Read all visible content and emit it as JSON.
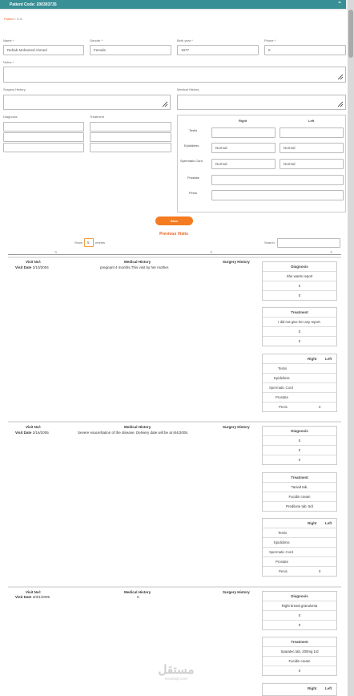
{
  "header": {
    "title": "Patient Code: 200303735"
  },
  "breadcrumb": {
    "home": "Patient",
    "current": "Edit"
  },
  "form": {
    "name": {
      "label": "Name *",
      "value": "Rehab Mohamed Ahmed"
    },
    "gender": {
      "label": "Gender *",
      "value": "Female"
    },
    "birth_year": {
      "label": "Birth year *",
      "value": "1977"
    },
    "phone": {
      "label": "Phone *",
      "value": "0"
    },
    "notes": {
      "label": "Notes *"
    },
    "surgery_history": {
      "label": "Surgery History"
    },
    "medical_history": {
      "label": "Medical History"
    },
    "diagnosis": {
      "label": "Diagnosis"
    },
    "treatment": {
      "label": "Treatment"
    }
  },
  "exam": {
    "right_label": "Right",
    "left_label": "Left",
    "rows": [
      {
        "label": "Testis",
        "right": "",
        "left": ""
      },
      {
        "label": "Epididimis",
        "right": "Normal",
        "left": "Normal"
      },
      {
        "label": "Spermatic Cord",
        "right": "Normal",
        "left": "Normal"
      },
      {
        "label": "Prostate",
        "right": "",
        "left": ""
      },
      {
        "label": "Penis",
        "right": "",
        "left": ""
      }
    ]
  },
  "save_label": "Save",
  "previous_visits": {
    "title": "Previous Visits",
    "show_label": "Show",
    "show_value": "5",
    "entries_label": "entries",
    "search_label": "Search:",
    "visit_no_label": "Visit No/:",
    "visit_date_label": "Visit Date",
    "medical_history_label": "Medical History",
    "surgery_history_label": "Surgery History",
    "diagnosis_label": "Diagnosis",
    "treatment_label": "Treatment",
    "right_label": "Right",
    "left_label": "Left",
    "exam_labels": [
      "Testis",
      "Epididimis",
      "Spermatic Cord",
      "Prostate",
      "Penis"
    ],
    "visits": [
      {
        "date": "2/10/2004",
        "medical_history": "pregnant 4 months.This visit by her mother.",
        "diagnosis": [
          "She wants report",
          "0",
          "0"
        ],
        "treatment": [
          "I did not give her any report.",
          "0",
          "0"
        ],
        "exam_left": [
          "",
          "",
          "",
          "",
          "0"
        ]
      },
      {
        "date": "2/16/2005",
        "medical_history": "Severe exacerbation of the disease. Delivery date will be at 8/4/2005.",
        "diagnosis": [
          "0",
          "0",
          "0"
        ],
        "treatment": [
          "Tarivid tab.",
          "Fucidin cream",
          "Predilone tab. 5/d"
        ],
        "exam_left": [
          "",
          "",
          "",
          "",
          "0"
        ]
      },
      {
        "date": "3/3/1/2005",
        "medical_history": "0",
        "diagnosis": [
          "Right breast granuloma",
          "0",
          "0"
        ],
        "treatment": [
          "Sparatec tab. 200mg 1/d",
          "Fucidin cream",
          "0"
        ],
        "exam_left": []
      }
    ]
  },
  "watermark": {
    "arabic": "مستقل",
    "latin": "mostaql.com"
  },
  "colors": {
    "header": "#388f96",
    "accent": "#f47b20"
  }
}
